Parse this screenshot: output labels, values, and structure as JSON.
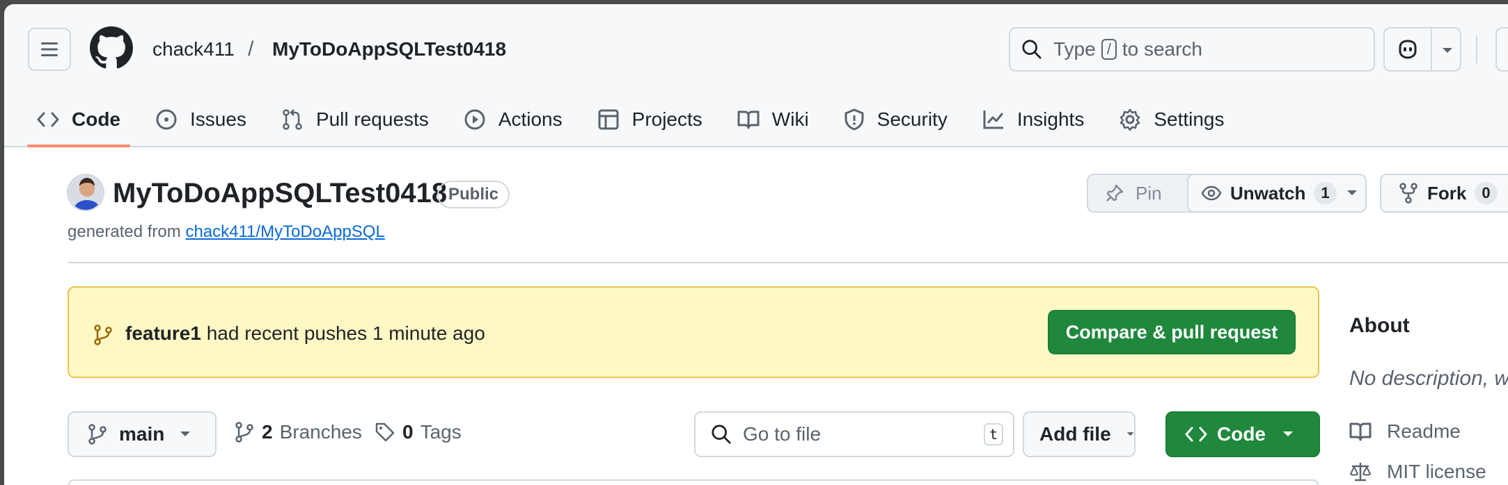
{
  "header": {
    "owner": "chack411",
    "separator": "/",
    "repo": "MyToDoAppSQLTest0418",
    "search": {
      "prefix": "Type",
      "key": "/",
      "suffix": "to search"
    }
  },
  "tabs": [
    {
      "label": "Code",
      "icon": "code-icon",
      "active": true
    },
    {
      "label": "Issues",
      "icon": "issue-icon"
    },
    {
      "label": "Pull requests",
      "icon": "pull-request-icon"
    },
    {
      "label": "Actions",
      "icon": "play-icon"
    },
    {
      "label": "Projects",
      "icon": "table-icon"
    },
    {
      "label": "Wiki",
      "icon": "book-icon"
    },
    {
      "label": "Security",
      "icon": "shield-icon"
    },
    {
      "label": "Insights",
      "icon": "graph-icon"
    },
    {
      "label": "Settings",
      "icon": "gear-icon"
    }
  ],
  "repo_header": {
    "title": "MyToDoAppSQLTest0418",
    "visibility": "Public",
    "generated_prefix": "generated from",
    "generated_link": "chack411/MyToDoAppSQL",
    "pin_label": "Pin",
    "unwatch_label": "Unwatch",
    "watch_count": "1",
    "fork_label": "Fork",
    "fork_count": "0"
  },
  "banner": {
    "branch": "feature1",
    "message": "had recent pushes 1 minute ago",
    "button": "Compare & pull request"
  },
  "toolbar": {
    "branch": "main",
    "branches_count": "2",
    "branches_label": "Branches",
    "tags_count": "0",
    "tags_label": "Tags",
    "goto_placeholder": "Go to file",
    "goto_key": "t",
    "add_file": "Add file",
    "code": "Code"
  },
  "about": {
    "title": "About",
    "description": "No description, w",
    "readme": "Readme",
    "license": "MIT license"
  },
  "colors": {
    "accent_green": "#1f883d",
    "tab_underline": "#fd8c73",
    "banner_bg": "#fff8c5",
    "link": "#0969da"
  }
}
